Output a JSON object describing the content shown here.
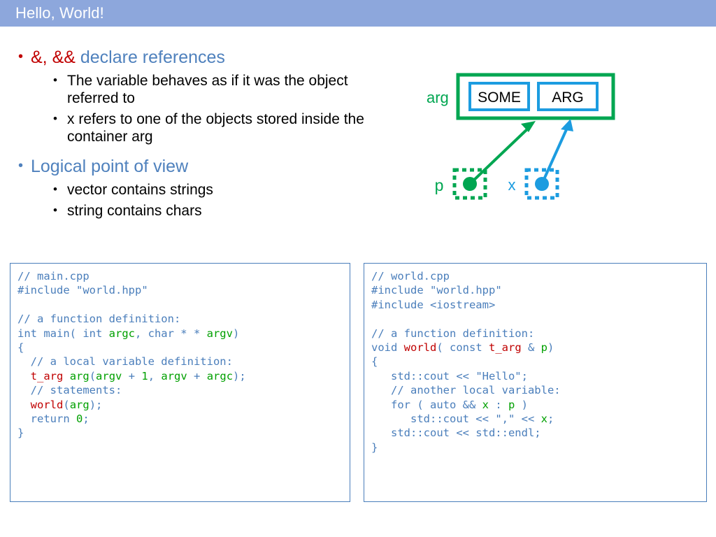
{
  "header": {
    "title": "Hello, World!",
    "bg_color": "#8da7dc",
    "text_color": "#ffffff"
  },
  "colors": {
    "accent_blue": "#4f81bd",
    "red": "#c00000",
    "code_blue": "#4a7ebb",
    "code_green": "#00a000",
    "diagram_green": "#00a651",
    "diagram_blue": "#1c9ce0"
  },
  "bullets": [
    {
      "level": 1,
      "bullet_color": "#c00000",
      "segments": [
        {
          "text": "&, &&",
          "color": "#c00000"
        },
        {
          "text": " declare references",
          "color": "#4f81bd"
        }
      ],
      "children": [
        "The variable behaves as if it was the object referred to",
        "x refers to one of the objects stored inside the container arg"
      ]
    },
    {
      "level": 1,
      "bullet_color": "#4f81bd",
      "segments": [
        {
          "text": "Logical point of view",
          "color": "#4f81bd"
        }
      ],
      "children": [
        "vector contains strings",
        "string contains chars"
      ]
    }
  ],
  "diagram": {
    "container_label": "arg",
    "container_label_color": "#00a651",
    "cells": [
      {
        "label": "SOME",
        "border_color": "#1c9ce0"
      },
      {
        "label": "ARG",
        "border_color": "#1c9ce0"
      }
    ],
    "pointers": [
      {
        "label": "p",
        "color": "#00a651",
        "target": "SOME"
      },
      {
        "label": "x",
        "color": "#1c9ce0",
        "target": "ARG"
      }
    ]
  },
  "code_left": {
    "filename_comment": "// main.cpp",
    "lines": [
      [
        {
          "t": "// main.cpp",
          "c": "cm"
        }
      ],
      [
        {
          "t": "#include ",
          "c": "cm"
        },
        {
          "t": "\"world.hpp\"",
          "c": "st"
        }
      ],
      [
        {
          "t": "",
          "c": "cm"
        }
      ],
      [
        {
          "t": "// a function definition:",
          "c": "cm"
        }
      ],
      [
        {
          "t": "int main( int ",
          "c": "kw"
        },
        {
          "t": "argc",
          "c": "id"
        },
        {
          "t": ", char * * ",
          "c": "kw"
        },
        {
          "t": "argv",
          "c": "id"
        },
        {
          "t": ")",
          "c": "kw"
        }
      ],
      [
        {
          "t": "{",
          "c": "kw"
        }
      ],
      [
        {
          "t": "  // a local variable definition:",
          "c": "cm"
        }
      ],
      [
        {
          "t": "  ",
          "c": "kw"
        },
        {
          "t": "t_arg",
          "c": "ty"
        },
        {
          "t": " ",
          "c": "kw"
        },
        {
          "t": "arg",
          "c": "id"
        },
        {
          "t": "(",
          "c": "kw"
        },
        {
          "t": "argv",
          "c": "id"
        },
        {
          "t": " + ",
          "c": "kw"
        },
        {
          "t": "1",
          "c": "id"
        },
        {
          "t": ", ",
          "c": "kw"
        },
        {
          "t": "argv",
          "c": "id"
        },
        {
          "t": " + ",
          "c": "kw"
        },
        {
          "t": "argc",
          "c": "id"
        },
        {
          "t": ");",
          "c": "kw"
        }
      ],
      [
        {
          "t": "  // statements:",
          "c": "cm"
        }
      ],
      [
        {
          "t": "  ",
          "c": "kw"
        },
        {
          "t": "world",
          "c": "ty"
        },
        {
          "t": "(",
          "c": "kw"
        },
        {
          "t": "arg",
          "c": "id"
        },
        {
          "t": ");",
          "c": "kw"
        }
      ],
      [
        {
          "t": "  return ",
          "c": "kw"
        },
        {
          "t": "0",
          "c": "id"
        },
        {
          "t": ";",
          "c": "kw"
        }
      ],
      [
        {
          "t": "}",
          "c": "kw"
        }
      ]
    ]
  },
  "code_right": {
    "filename_comment": "// world.cpp",
    "lines": [
      [
        {
          "t": "// world.cpp",
          "c": "cm"
        }
      ],
      [
        {
          "t": "#include ",
          "c": "cm"
        },
        {
          "t": "\"world.hpp\"",
          "c": "st"
        }
      ],
      [
        {
          "t": "#include <iostream>",
          "c": "cm"
        }
      ],
      [
        {
          "t": "",
          "c": "cm"
        }
      ],
      [
        {
          "t": "// a function definition:",
          "c": "cm"
        }
      ],
      [
        {
          "t": "void ",
          "c": "kw"
        },
        {
          "t": "world",
          "c": "ty"
        },
        {
          "t": "( const ",
          "c": "kw"
        },
        {
          "t": "t_arg",
          "c": "ty"
        },
        {
          "t": " & ",
          "c": "kw"
        },
        {
          "t": "p",
          "c": "id"
        },
        {
          "t": ")",
          "c": "kw"
        }
      ],
      [
        {
          "t": "{",
          "c": "kw"
        }
      ],
      [
        {
          "t": "   std::cout << ",
          "c": "kw"
        },
        {
          "t": "\"Hello\"",
          "c": "st"
        },
        {
          "t": ";",
          "c": "kw"
        }
      ],
      [
        {
          "t": "   // another local variable:",
          "c": "cm"
        }
      ],
      [
        {
          "t": "   for ( auto && ",
          "c": "kw"
        },
        {
          "t": "x",
          "c": "id"
        },
        {
          "t": " : ",
          "c": "kw"
        },
        {
          "t": "p",
          "c": "id"
        },
        {
          "t": " )",
          "c": "kw"
        }
      ],
      [
        {
          "t": "      std::cout << ",
          "c": "kw"
        },
        {
          "t": "\",\"",
          "c": "st"
        },
        {
          "t": " << ",
          "c": "kw"
        },
        {
          "t": "x",
          "c": "id"
        },
        {
          "t": ";",
          "c": "kw"
        }
      ],
      [
        {
          "t": "   std::cout << std::endl;",
          "c": "kw"
        }
      ],
      [
        {
          "t": "}",
          "c": "kw"
        }
      ]
    ]
  }
}
